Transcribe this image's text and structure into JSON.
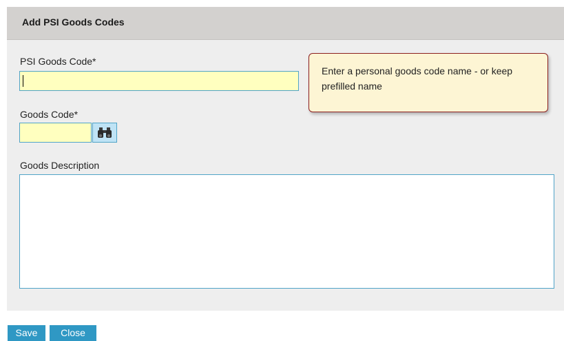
{
  "dialog": {
    "title": "Add PSI Goods Codes"
  },
  "form": {
    "psi_goods_code_label": "PSI Goods Code*",
    "psi_goods_code_value": "",
    "goods_code_label": "Goods Code*",
    "goods_code_value": "",
    "goods_description_label": "Goods Description",
    "goods_description_value": ""
  },
  "tooltip": {
    "text": "Enter a personal goods code name - or keep prefilled name"
  },
  "actions": {
    "save_label": "Save",
    "close_label": "Close"
  },
  "icons": {
    "lookup": "binoculars-icon"
  },
  "colors": {
    "input_bg": "#ffffbf",
    "input_border": "#4fa3c7",
    "button_bg": "#2f98c4",
    "tooltip_border": "#8b1e1e",
    "tooltip_bg": "#fdf5d4",
    "header_bg": "#d3d1cf"
  }
}
